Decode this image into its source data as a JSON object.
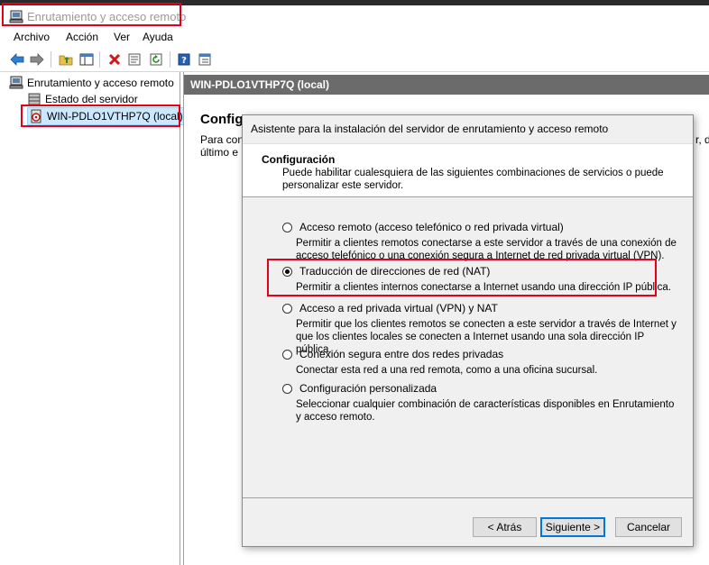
{
  "window": {
    "title": "Enrutamiento y acceso remoto"
  },
  "menu": {
    "items": [
      "Archivo",
      "Acción",
      "Ver",
      "Ayuda"
    ]
  },
  "toolbar": {
    "icons": [
      "back-arrow-icon",
      "forward-arrow-icon",
      "up-folder-icon",
      "show-hide-tree-icon",
      "delete-icon",
      "properties-icon",
      "refresh-icon",
      "help-icon",
      "view-icon"
    ]
  },
  "tree": {
    "root": "Enrutamiento y acceso remoto",
    "server_status": "Estado del servidor",
    "server_node": "WIN-PDLO1VTHP7Q (local)"
  },
  "right_pane": {
    "header": "WIN-PDLO1VTHP7Q (local)",
    "heading": "Configurar Enrutamiento y acceso remoto",
    "line1": "Para configurar",
    "line2": "último e",
    "line1_tail": "r, d"
  },
  "dialog": {
    "title": "Asistente para la instalación del servidor de enrutamiento y acceso remoto",
    "section_title": "Configuración",
    "section_desc": "Puede habilitar cualesquiera de las siguientes combinaciones de servicios o puede personalizar este servidor.",
    "options": [
      {
        "label": "Acceso remoto (acceso telefónico o red privada virtual)",
        "desc": "Permitir a clientes remotos conectarse a este servidor a través de una conexión de acceso telefónico o una conexión segura a Internet de red privada virtual (VPN).",
        "selected": false
      },
      {
        "label": "Traducción de direcciones de red (NAT)",
        "desc": "Permitir a clientes internos conectarse a Internet usando una dirección IP pública.",
        "selected": true
      },
      {
        "label": "Acceso a red privada virtual (VPN) y NAT",
        "desc": "Permitir que los clientes remotos se conecten a este servidor a través de Internet y que los clientes locales se conecten a Internet usando una sola dirección IP pública.",
        "selected": false
      },
      {
        "label": "Conexión segura entre dos redes privadas",
        "desc": "Conectar esta red a una red remota, como a una oficina sucursal.",
        "selected": false
      },
      {
        "label": "Configuración personalizada",
        "desc": "Seleccionar cualquier combinación de características disponibles en Enrutamiento y acceso remoto.",
        "selected": false
      }
    ],
    "buttons": {
      "back": "< Atrás",
      "next": "Siguiente >",
      "cancel": "Cancelar"
    }
  },
  "colors": {
    "highlight": "#e3001b",
    "header_bg": "#6b6b6b",
    "dialog_bg": "#f0f0f0",
    "selection_bg": "#cce8ff"
  }
}
